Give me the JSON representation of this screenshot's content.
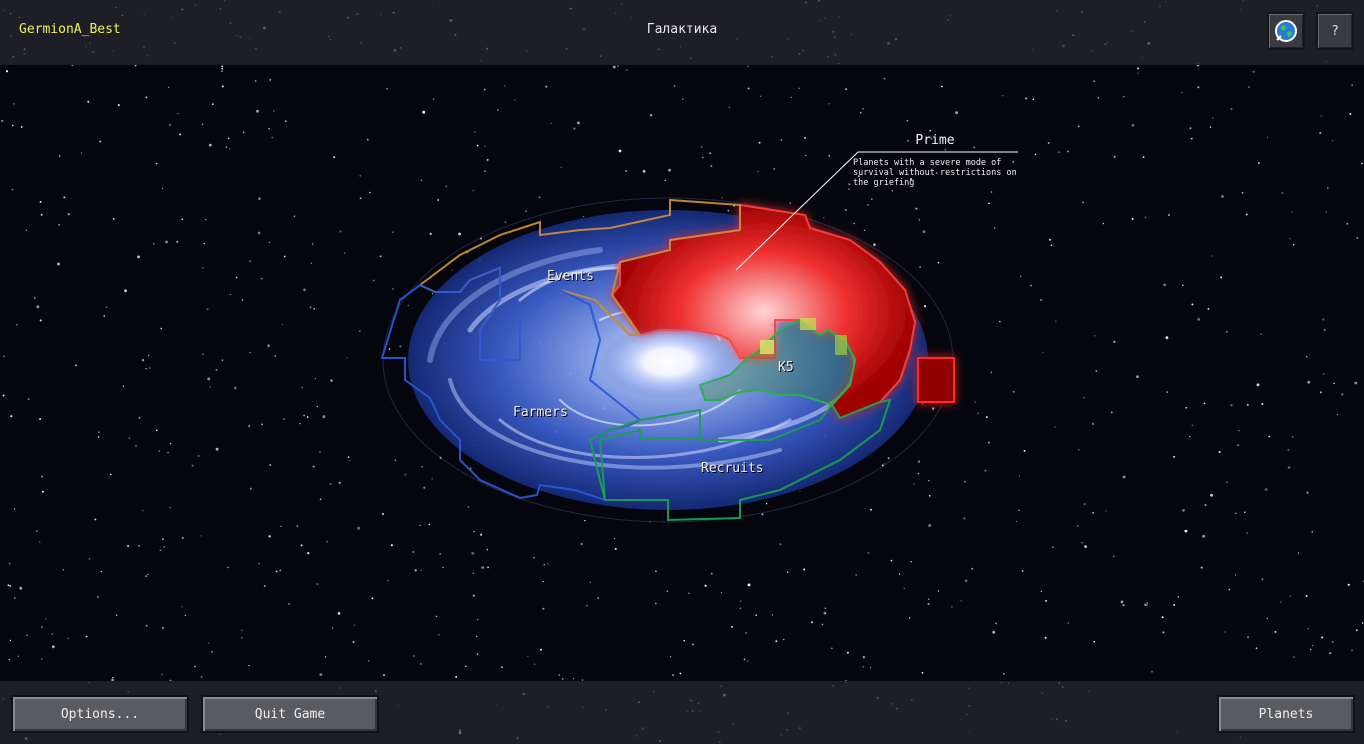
{
  "header": {
    "username": "GermionA_Best",
    "title": "Галактика",
    "globe_icon": "globe-icon",
    "help_label": "?"
  },
  "galaxy": {
    "sectors": [
      {
        "name": "Events",
        "color": "#c98a3a"
      },
      {
        "name": "Farmers",
        "color": "#2b56d8"
      },
      {
        "name": "Recruits",
        "color": "#18a050"
      },
      {
        "name": "K5",
        "color": "#b8d04a"
      },
      {
        "name": "Prime",
        "color": "#e01010"
      }
    ],
    "callout": {
      "title": "Prime",
      "description": "Planets with a severe mode of survival without restrictions on the griefing"
    }
  },
  "footer": {
    "options_label": "Options...",
    "quit_label": "Quit Game",
    "planets_label": "Planets"
  }
}
